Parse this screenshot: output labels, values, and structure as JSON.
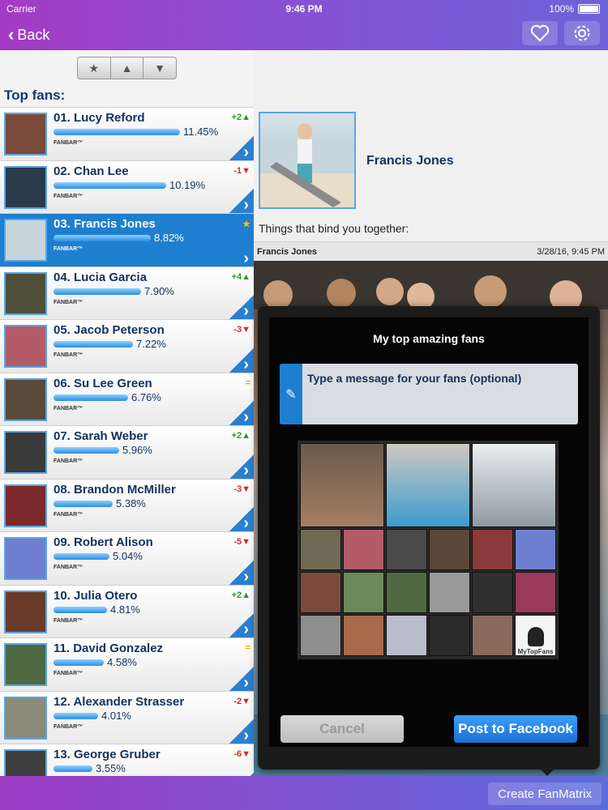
{
  "status_bar": {
    "carrier": "Carrier",
    "time": "9:46 PM",
    "battery": "100%"
  },
  "nav": {
    "back_label": "Back",
    "heart_icon": "heart-icon",
    "settings_icon": "gear-icon"
  },
  "left_panel": {
    "title": "Top fans:",
    "sort_buttons": [
      "star",
      "up",
      "down"
    ],
    "fanbar_label": "FANBAR™",
    "fans": [
      {
        "name": "01. Lucy Reford",
        "pct": "11.45%",
        "value": 11.45,
        "change": "+2",
        "dir": "up"
      },
      {
        "name": "02. Chan Lee",
        "pct": "10.19%",
        "value": 10.19,
        "change": "-1",
        "dir": "down"
      },
      {
        "name": "03. Francis Jones",
        "pct": "8.82%",
        "value": 8.82,
        "change": "",
        "dir": "star"
      },
      {
        "name": "04. Lucia Garcia",
        "pct": "7.90%",
        "value": 7.9,
        "change": "+4",
        "dir": "up"
      },
      {
        "name": "05. Jacob Peterson",
        "pct": "7.22%",
        "value": 7.22,
        "change": "-3",
        "dir": "down"
      },
      {
        "name": "06. Su Lee Green",
        "pct": "6.76%",
        "value": 6.76,
        "change": "=",
        "dir": "same"
      },
      {
        "name": "07. Sarah Weber",
        "pct": "5.96%",
        "value": 5.96,
        "change": "+2",
        "dir": "up"
      },
      {
        "name": "08. Brandon McMiller",
        "pct": "5.38%",
        "value": 5.38,
        "change": "-3",
        "dir": "down"
      },
      {
        "name": "09. Robert Alison",
        "pct": "5.04%",
        "value": 5.04,
        "change": "-5",
        "dir": "down"
      },
      {
        "name": "10. Julia Otero",
        "pct": "4.81%",
        "value": 4.81,
        "change": "+2",
        "dir": "up"
      },
      {
        "name": "11. David Gonzalez",
        "pct": "4.58%",
        "value": 4.58,
        "change": "=",
        "dir": "same"
      },
      {
        "name": "12. Alexander Strasser",
        "pct": "4.01%",
        "value": 4.01,
        "change": "-2",
        "dir": "down"
      },
      {
        "name": "13. George Gruber",
        "pct": "3.55%",
        "value": 3.55,
        "change": "-6",
        "dir": "down"
      }
    ]
  },
  "right_panel": {
    "profile_name": "Francis Jones",
    "bind_text": "Things that bind you together:",
    "post_author": "Francis Jones",
    "post_date": "3/28/16, 9:45 PM"
  },
  "dialog": {
    "title": "My top amazing fans",
    "message_placeholder": "Type a message for your fans (optional)",
    "logo_text": "MyTopFans",
    "cancel_label": "Cancel",
    "post_label": "Post to Facebook"
  },
  "bottom_bar": {
    "create_label": "Create FanMatrix"
  }
}
